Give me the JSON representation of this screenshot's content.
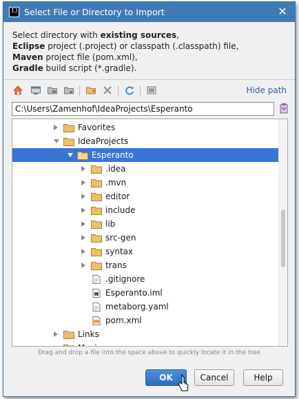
{
  "window": {
    "title": "Select File or Directory to Import",
    "close_glyph": "✕"
  },
  "description": {
    "line1_pre": "Select directory with ",
    "line1_bold": "existing sources",
    "line1_post": ",",
    "line2_bold": "Eclipse",
    "line2_rest": " project (.project) or classpath (.classpath) file,",
    "line3_bold": "Maven",
    "line3_rest": " project file (pom.xml),",
    "line4_bold": "Gradle",
    "line4_rest": " build script (*.gradle)."
  },
  "toolbar": {
    "icons": [
      "home-icon",
      "desktop-icon",
      "project-folder-icon",
      "module-folder-icon",
      "new-folder-icon",
      "delete-icon",
      "refresh-icon",
      "show-hidden-icon"
    ],
    "hide_path_label": "Hide path"
  },
  "path": {
    "value": "C:\\Users\\Zamenhof\\IdeaProjects\\Esperanto"
  },
  "tree": {
    "rows": [
      {
        "label": "Favorites",
        "type": "folder",
        "expanded": false
      },
      {
        "label": "IdeaProjects",
        "type": "folder",
        "expanded": true
      },
      {
        "label": "Esperanto",
        "type": "folder",
        "expanded": true,
        "selected": true
      },
      {
        "label": ".idea",
        "type": "folder",
        "expanded": false
      },
      {
        "label": ".mvn",
        "type": "folder",
        "expanded": false
      },
      {
        "label": "editor",
        "type": "folder",
        "expanded": false
      },
      {
        "label": "include",
        "type": "folder",
        "expanded": false
      },
      {
        "label": "lib",
        "type": "folder",
        "expanded": false
      },
      {
        "label": "src-gen",
        "type": "folder",
        "expanded": false
      },
      {
        "label": "syntax",
        "type": "folder",
        "expanded": false
      },
      {
        "label": "trans",
        "type": "folder",
        "expanded": false
      },
      {
        "label": ".gitignore",
        "type": "file"
      },
      {
        "label": "Esperanto.iml",
        "type": "iml"
      },
      {
        "label": "metaborg.yaml",
        "type": "file"
      },
      {
        "label": "pom.xml",
        "type": "xml"
      },
      {
        "label": "Links",
        "type": "folder",
        "expanded": false
      },
      {
        "label": "Music",
        "type": "folder",
        "expanded": false
      }
    ]
  },
  "hint": "Drag and drop a file into the space above to quickly locate it in the tree",
  "buttons": {
    "ok": "OK",
    "cancel": "Cancel",
    "help": "Help"
  },
  "colors": {
    "selection": "#3875d6",
    "title_bar": "#3f7cb6",
    "folder": "#e8c16a"
  }
}
